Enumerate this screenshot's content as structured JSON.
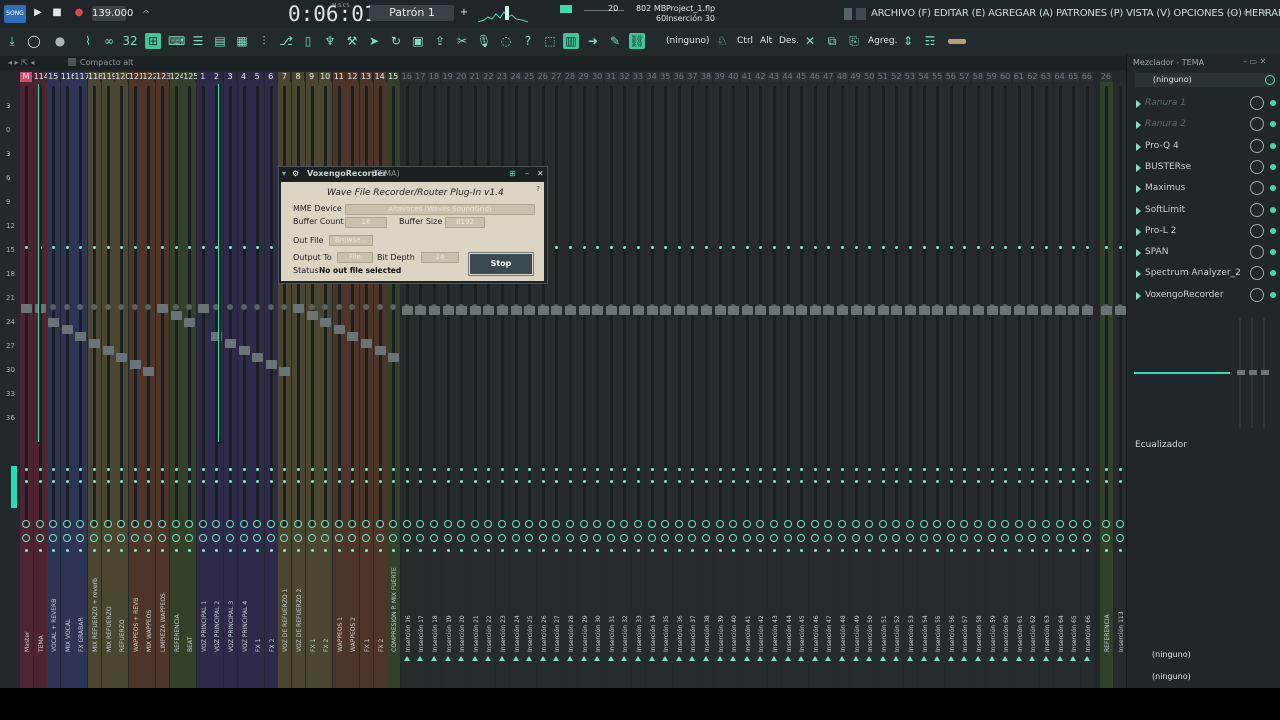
{
  "titlebar": {
    "song_badge": "SONG",
    "tempo": "139.000",
    "time": "0:06:01",
    "time_unit": "M:S:CS",
    "pattern": "Patrón 1",
    "cpu_value": "20",
    "memory": "802 MB",
    "polyphony": "60",
    "project": "Project_1.flp",
    "insert": "Inserción 30",
    "menu": "ARCHIVO (F) EDITAR (E) AGREGAR (A) PATRONES (P) VISTA (V) OPCIONES (O) HERRAMIENTAS (T) AYUDA"
  },
  "toolbar": {
    "none_label": "(ninguno)",
    "ctrl": "Ctrl",
    "alt": "Alt",
    "des": "Des.",
    "agreg": "Agreg."
  },
  "mixer": {
    "compact_label": "Compacto alt",
    "scale": [
      "3",
      "0",
      "3",
      "6",
      "9",
      "12",
      "15",
      "18",
      "21",
      "24",
      "27",
      "30",
      "33",
      "36"
    ],
    "track_numbers": [
      "M",
      "114",
      "15",
      "116",
      "117",
      "118",
      "119",
      "120",
      "121",
      "122",
      "123",
      "124",
      "125",
      "1",
      "2",
      "3",
      "4",
      "5",
      "6",
      "7",
      "8",
      "9",
      "10",
      "11",
      "12",
      "13",
      "14",
      "15",
      "16",
      "17",
      "18",
      "19",
      "20",
      "21",
      "22",
      "23",
      "24",
      "25",
      "26",
      "27",
      "28",
      "29",
      "30",
      "31",
      "32",
      "33",
      "34",
      "35",
      "36",
      "37",
      "38",
      "39",
      "40",
      "41",
      "42",
      "43",
      "44",
      "45",
      "46",
      "47",
      "48",
      "49",
      "50",
      "51",
      "52",
      "53",
      "54",
      "55",
      "56",
      "57",
      "58",
      "59",
      "60",
      "61",
      "62",
      "63",
      "64",
      "65",
      "66",
      "26"
    ],
    "strip_names": [
      "Master",
      "TEMA",
      "VOCAL + REVERB",
      "MIX VOCAL",
      "FX GRABAR",
      "MIX REFUERZO + reverb",
      "MIX REFUERZO",
      "REFUERZO",
      "WAPPEOS + REVB",
      "MIX WAPPEOS",
      "LIMPIEZA WAPPEOS",
      "REFERENCIA",
      "BEAT",
      "VOZ PRINCIPAL 1",
      "VOZ PRINCIPAL 2",
      "VOZ PRINCIPAL 3",
      "VOZ PRINCIPAL 4",
      "FX 1",
      "FX 2",
      "VOZ DE REFUERZO 1",
      "VOZ DE REFUERZO 2",
      "FX 1",
      "FX 2",
      "WAPPEOS 1",
      "WAPPEOS 2",
      "FX 1",
      "FX 2",
      "COMPRESIÓN P. MIX FUERTE",
      "Inserción 16",
      "Inserción 17",
      "Inserción 18",
      "Inserción 19",
      "Inserción 20",
      "Inserción 21",
      "Inserción 22",
      "Inserción 23",
      "Inserción 24",
      "Inserción 25",
      "Inserción 26",
      "Inserción 27",
      "Inserción 28",
      "Inserción 29",
      "Inserción 30",
      "Inserción 31",
      "Inserción 32",
      "Inserción 33",
      "Inserción 34",
      "Inserción 35",
      "Inserción 36",
      "Inserción 37",
      "Inserción 38",
      "Inserción 39",
      "Inserción 40",
      "Inserción 41",
      "Inserción 42",
      "Inserción 43",
      "Inserción 44",
      "Inserción 45",
      "Inserción 46",
      "Inserción 47",
      "Inserción 48",
      "Inserción 49",
      "Inserción 50",
      "Inserción 51",
      "Inserción 52",
      "Inserción 53",
      "Inserción 54",
      "Inserción 55",
      "Inserción 56",
      "Inserción 57",
      "Inserción 58",
      "Inserción 59",
      "Inserción 60",
      "Inserción 61",
      "Inserción 62",
      "Inserción 63",
      "Inserción 64",
      "Inserción 65",
      "Inserción 66",
      "REFERENCIA",
      "Inserción 113"
    ]
  },
  "plugin": {
    "title": "VoxengoRecorder",
    "title_suffix": "(TEMA)",
    "heading": "Wave File Recorder/Router Plug-In v1.4",
    "help": "?",
    "mme_label": "MME Device",
    "mme_value": "Altavoces (Waves SoundGrid)",
    "buffer_count_label": "Buffer Count",
    "buffer_count_value": "16",
    "buffer_size_label": "Buffer Size",
    "buffer_size_value": "8192",
    "out_file_label": "Out File",
    "browse_label": "Browse...",
    "output_to_label": "Output To",
    "output_to_value": "File",
    "bit_depth_label": "Bit Depth",
    "bit_depth_value": "24",
    "status_label": "Status",
    "status_value": "No out file selected",
    "stop_label": "Stop"
  },
  "right_panel": {
    "title": "Mezclador - TEMA",
    "preset": "(ninguno)",
    "slots": [
      {
        "label": "Ranura 1",
        "empty": true
      },
      {
        "label": "Ranura 2",
        "empty": true
      },
      {
        "label": "Pro-Q 4",
        "empty": false
      },
      {
        "label": "BUSTERse",
        "empty": false
      },
      {
        "label": "Maximus",
        "empty": false
      },
      {
        "label": "SoftLimit",
        "empty": false
      },
      {
        "label": "Pro-L 2",
        "empty": false
      },
      {
        "label": "SPAN",
        "empty": false
      },
      {
        "label": "Spectrum Analyzer_2",
        "empty": false
      },
      {
        "label": "VoxengoRecorder",
        "empty": false
      }
    ],
    "eq_label": "Ecualizador",
    "input": "(ninguno)",
    "output": "(ninguno)"
  },
  "colors": {
    "accent": "#3fd9b0",
    "master_strip": "#4e2432",
    "vocal_strip": "#2e3456",
    "refuerzo_strip": "#4a4630",
    "wappeos_strip": "#4e3529",
    "referencia_strip": "#33412a",
    "vozprincipal_strip": "#2e2b4a"
  }
}
